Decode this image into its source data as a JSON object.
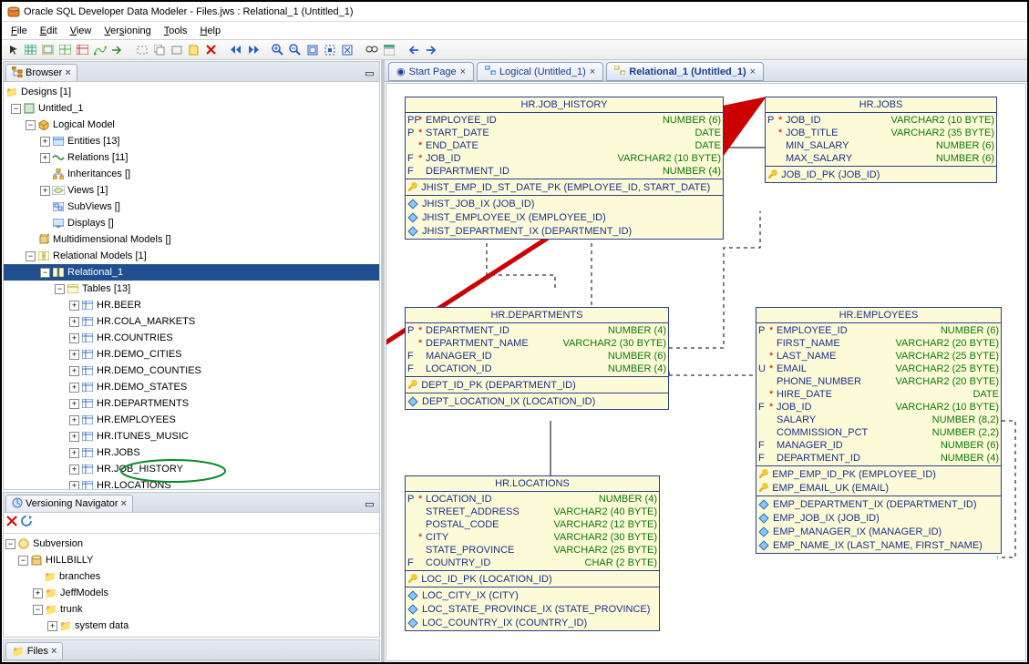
{
  "window": {
    "title": "Oracle SQL Developer Data Modeler - Files.jws : Relational_1 (Untitled_1)"
  },
  "menu": [
    "File",
    "Edit",
    "View",
    "Versioning",
    "Tools",
    "Help"
  ],
  "browser": {
    "tab": "Browser",
    "root": "Designs [1]",
    "design": "Untitled_1",
    "logical": "Logical Model",
    "entities": "Entities [13]",
    "relations": "Relations [11]",
    "inheritances": "Inheritances []",
    "views": "Views [1]",
    "subviews": "SubViews []",
    "displays": "Displays []",
    "multidim": "Multidimensional Models []",
    "relmodels": "Relational Models [1]",
    "rel1": "Relational_1",
    "tables": "Tables [13]",
    "tablelist": [
      "HR.BEER",
      "HR.COLA_MARKETS",
      "HR.COUNTRIES",
      "HR.DEMO_CITIES",
      "HR.DEMO_COUNTIES",
      "HR.DEMO_STATES",
      "HR.DEPARTMENTS",
      "HR.EMPLOYEES",
      "HR.ITUNES_MUSIC",
      "HR.JOBS",
      "HR.JOB_HISTORY",
      "HR.LOCATIONS"
    ]
  },
  "versioning": {
    "tab": "Versioning Navigator",
    "root": "Subversion",
    "repo": "HILLBILLY",
    "branches": "branches",
    "jeff": "JeffModels",
    "trunk": "trunk",
    "sys": "system data"
  },
  "files_tab": "Files",
  "editor_tabs": {
    "start": "Start Page",
    "logical": "Logical (Untitled_1)",
    "rel": "Relational_1 (Untitled_1)"
  },
  "entities": {
    "job_history": {
      "title": "HR.JOB_HISTORY",
      "cols": [
        {
          "f": "PF",
          "s": "*",
          "n": "EMPLOYEE_ID",
          "t": "NUMBER (6)"
        },
        {
          "f": "P",
          "s": "*",
          "n": "START_DATE",
          "t": "DATE"
        },
        {
          "f": "",
          "s": "*",
          "n": "END_DATE",
          "t": "DATE"
        },
        {
          "f": "F",
          "s": "*",
          "n": "JOB_ID",
          "t": "VARCHAR2 (10 BYTE)"
        },
        {
          "f": "F",
          "s": "",
          "n": "DEPARTMENT_ID",
          "t": "NUMBER (4)"
        }
      ],
      "pk": "JHIST_EMP_ID_ST_DATE_PK (EMPLOYEE_ID, START_DATE)",
      "idx": [
        "JHIST_JOB_IX (JOB_ID)",
        "JHIST_EMPLOYEE_IX (EMPLOYEE_ID)",
        "JHIST_DEPARTMENT_IX (DEPARTMENT_ID)"
      ]
    },
    "jobs": {
      "title": "HR.JOBS",
      "cols": [
        {
          "f": "P",
          "s": "*",
          "n": "JOB_ID",
          "t": "VARCHAR2 (10 BYTE)"
        },
        {
          "f": "",
          "s": "*",
          "n": "JOB_TITLE",
          "t": "VARCHAR2 (35 BYTE)"
        },
        {
          "f": "",
          "s": "",
          "n": "MIN_SALARY",
          "t": "NUMBER (6)"
        },
        {
          "f": "",
          "s": "",
          "n": "MAX_SALARY",
          "t": "NUMBER (6)"
        }
      ],
      "pk": "JOB_ID_PK (JOB_ID)"
    },
    "departments": {
      "title": "HR.DEPARTMENTS",
      "cols": [
        {
          "f": "P",
          "s": "*",
          "n": "DEPARTMENT_ID",
          "t": "NUMBER (4)"
        },
        {
          "f": "",
          "s": "*",
          "n": "DEPARTMENT_NAME",
          "t": "VARCHAR2 (30 BYTE)"
        },
        {
          "f": "F",
          "s": "",
          "n": "MANAGER_ID",
          "t": "NUMBER (6)"
        },
        {
          "f": "F",
          "s": "",
          "n": "LOCATION_ID",
          "t": "NUMBER (4)"
        }
      ],
      "pk": "DEPT_ID_PK (DEPARTMENT_ID)",
      "idx": [
        "DEPT_LOCATION_IX (LOCATION_ID)"
      ]
    },
    "employees": {
      "title": "HR.EMPLOYEES",
      "cols": [
        {
          "f": "P",
          "s": "*",
          "n": "EMPLOYEE_ID",
          "t": "NUMBER (6)"
        },
        {
          "f": "",
          "s": "",
          "n": "FIRST_NAME",
          "t": "VARCHAR2 (20 BYTE)"
        },
        {
          "f": "",
          "s": "*",
          "n": "LAST_NAME",
          "t": "VARCHAR2 (25 BYTE)"
        },
        {
          "f": "U",
          "s": "*",
          "n": "EMAIL",
          "t": "VARCHAR2 (25 BYTE)"
        },
        {
          "f": "",
          "s": "",
          "n": "PHONE_NUMBER",
          "t": "VARCHAR2 (20 BYTE)"
        },
        {
          "f": "",
          "s": "*",
          "n": "HIRE_DATE",
          "t": "DATE"
        },
        {
          "f": "F",
          "s": "*",
          "n": "JOB_ID",
          "t": "VARCHAR2 (10 BYTE)"
        },
        {
          "f": "",
          "s": "",
          "n": "SALARY",
          "t": "NUMBER (8,2)"
        },
        {
          "f": "",
          "s": "",
          "n": "COMMISSION_PCT",
          "t": "NUMBER (2,2)"
        },
        {
          "f": "F",
          "s": "",
          "n": "MANAGER_ID",
          "t": "NUMBER (6)"
        },
        {
          "f": "F",
          "s": "",
          "n": "DEPARTMENT_ID",
          "t": "NUMBER (4)"
        }
      ],
      "pk": "EMP_EMP_ID_PK (EMPLOYEE_ID)",
      "uk": "EMP_EMAIL_UK (EMAIL)",
      "idx": [
        "EMP_DEPARTMENT_IX (DEPARTMENT_ID)",
        "EMP_JOB_IX (JOB_ID)",
        "EMP_MANAGER_IX (MANAGER_ID)",
        "EMP_NAME_IX (LAST_NAME, FIRST_NAME)"
      ]
    },
    "locations": {
      "title": "HR.LOCATIONS",
      "cols": [
        {
          "f": "P",
          "s": "*",
          "n": "LOCATION_ID",
          "t": "NUMBER (4)"
        },
        {
          "f": "",
          "s": "",
          "n": "STREET_ADDRESS",
          "t": "VARCHAR2 (40 BYTE)"
        },
        {
          "f": "",
          "s": "",
          "n": "POSTAL_CODE",
          "t": "VARCHAR2 (12 BYTE)"
        },
        {
          "f": "",
          "s": "*",
          "n": "CITY",
          "t": "VARCHAR2 (30 BYTE)"
        },
        {
          "f": "",
          "s": "",
          "n": "STATE_PROVINCE",
          "t": "VARCHAR2 (25 BYTE)"
        },
        {
          "f": "F",
          "s": "",
          "n": "COUNTRY_ID",
          "t": "CHAR (2 BYTE)"
        }
      ],
      "pk": "LOC_ID_PK (LOCATION_ID)",
      "idx": [
        "LOC_CITY_IX (CITY)",
        "LOC_STATE_PROVINCE_IX (STATE_PROVINCE)",
        "LOC_COUNTRY_IX (COUNTRY_ID)"
      ]
    }
  }
}
